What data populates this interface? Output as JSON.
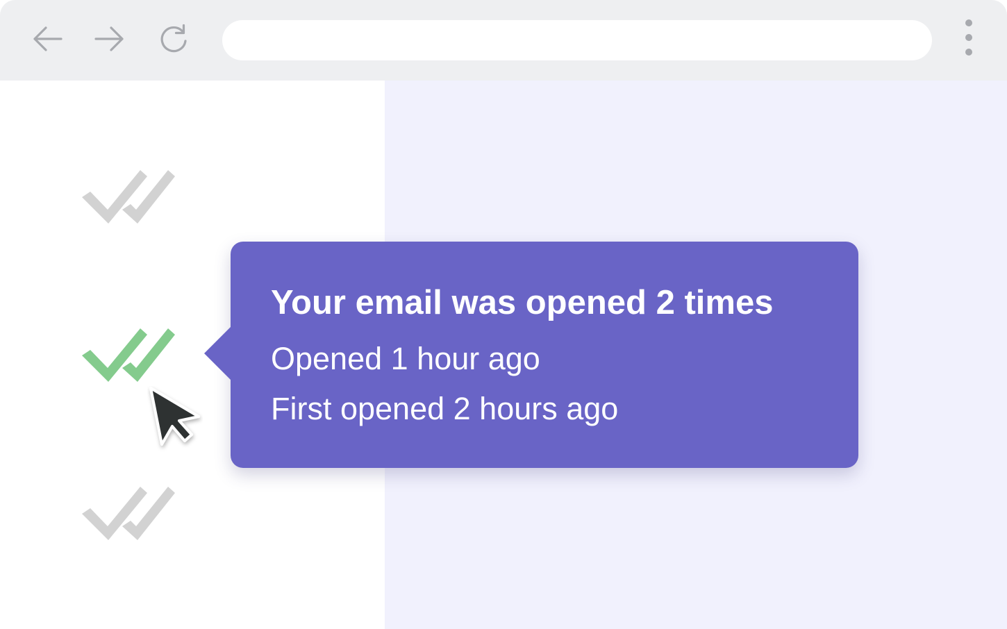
{
  "browser": {
    "address": {
      "value": "",
      "placeholder": ""
    },
    "icons": {
      "back": "arrow-left-icon",
      "forward": "arrow-right-icon",
      "reload": "reload-icon",
      "menu": "vertical-dots-menu-icon"
    }
  },
  "email_list": {
    "items": [
      {
        "status_icon": "double-check-icon",
        "state": "not-opened",
        "color": "#d2d2d2"
      },
      {
        "status_icon": "double-check-icon",
        "state": "opened",
        "color": "#84cb8d"
      },
      {
        "status_icon": "double-check-icon",
        "state": "not-opened",
        "color": "#d2d2d2"
      }
    ]
  },
  "tooltip": {
    "title": "Your email was opened 2 times",
    "last_opened": "Opened 1 hour ago",
    "first_opened": "First opened 2 hours ago",
    "background_color": "#6964c6"
  },
  "colors": {
    "toolbar": "#eeeff1",
    "content_right": "#f1f1fd",
    "icon_gray": "#a7a9ae"
  }
}
